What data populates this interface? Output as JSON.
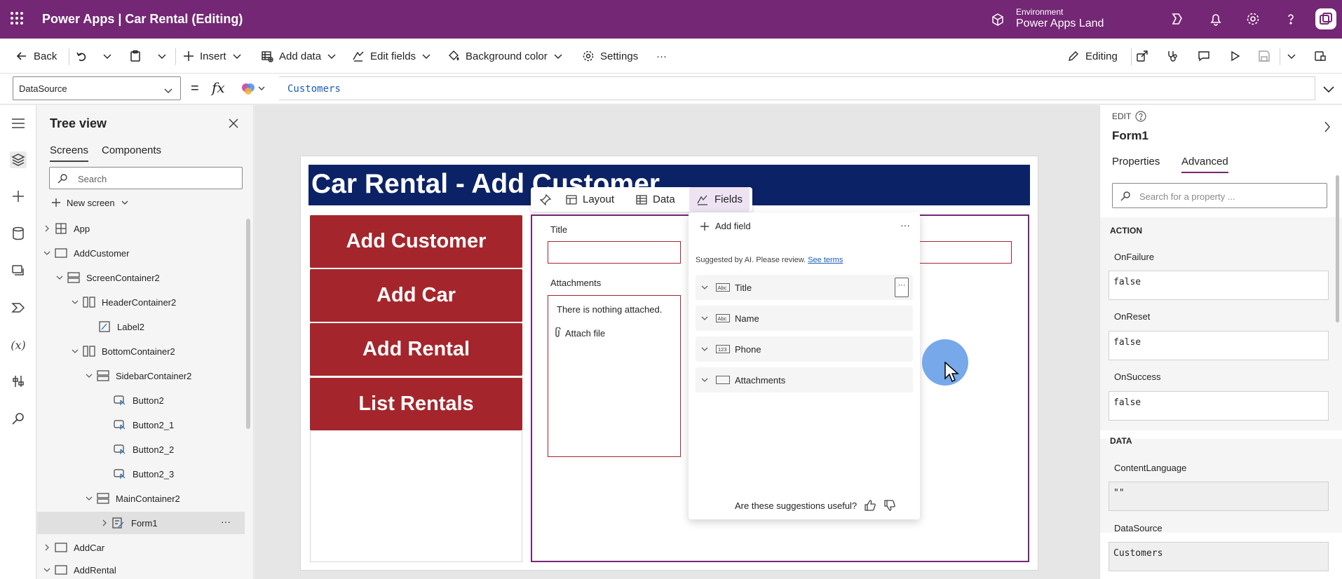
{
  "titlebar": {
    "app": "Power Apps | Car Rental (Editing)",
    "env_label": "Environment",
    "env_value": "Power Apps Land"
  },
  "cmdbar": {
    "back": "Back",
    "insert": "Insert",
    "add_data": "Add data",
    "edit_fields": "Edit fields",
    "background_color": "Background color",
    "settings": "Settings",
    "overflow": "···",
    "editing": "Editing"
  },
  "formula": {
    "property": "DataSource",
    "equals": "=",
    "fx": "fx",
    "value": "Customers"
  },
  "tree": {
    "title": "Tree view",
    "tabs": [
      "Screens",
      "Components"
    ],
    "search_placeholder": "Search",
    "new_screen": "New screen",
    "nodes": [
      "App",
      "AddCustomer",
      "ScreenContainer2",
      "HeaderContainer2",
      "Label2",
      "BottomContainer2",
      "SidebarContainer2",
      "Button2",
      "Button2_1",
      "Button2_2",
      "Button2_3",
      "MainContainer2",
      "Form1",
      "AddCar",
      "AddRental"
    ],
    "more": "···"
  },
  "canvas": {
    "header": "Car Rental - Add Customer",
    "buttons": [
      "Add Customer",
      "Add Car",
      "Add Rental",
      "List Rentals"
    ],
    "form": {
      "title_label": "Title",
      "attachments_label": "Attachments",
      "nothing_attached": "There is nothing attached.",
      "attach_file": "Attach file"
    }
  },
  "float_toolbar": {
    "layout": "Layout",
    "data": "Data",
    "fields": "Fields"
  },
  "fields_panel": {
    "add_field": "Add field",
    "more": "···",
    "suggested": "Suggested by AI. Please review.",
    "see_terms": "See terms",
    "fields": [
      {
        "name": "Title",
        "type_icon": "text-field-icon"
      },
      {
        "name": "Name",
        "type_icon": "text-field-icon"
      },
      {
        "name": "Phone",
        "type_icon": "number-field-icon"
      },
      {
        "name": "Attachments",
        "type_icon": "attachment-field-icon"
      }
    ],
    "row_more": "···",
    "useful": "Are these suggestions useful?"
  },
  "props": {
    "edit": "EDIT",
    "control": "Form1",
    "tabs": [
      "Properties",
      "Advanced"
    ],
    "search_placeholder": "Search for a property ...",
    "action_header": "ACTION",
    "data_header": "DATA",
    "on_failure_label": "OnFailure",
    "on_failure": "false",
    "on_reset_label": "OnReset",
    "on_reset": "false",
    "on_success_label": "OnSuccess",
    "on_success": "false",
    "content_language_label": "ContentLanguage",
    "content_language": "\"\"",
    "data_source_label": "DataSource",
    "data_source": "Customers"
  },
  "colors": {
    "brand": "#742774",
    "header_bar": "#0c2266",
    "button_red": "#a4262c",
    "formula_text": "#1a5db5"
  }
}
